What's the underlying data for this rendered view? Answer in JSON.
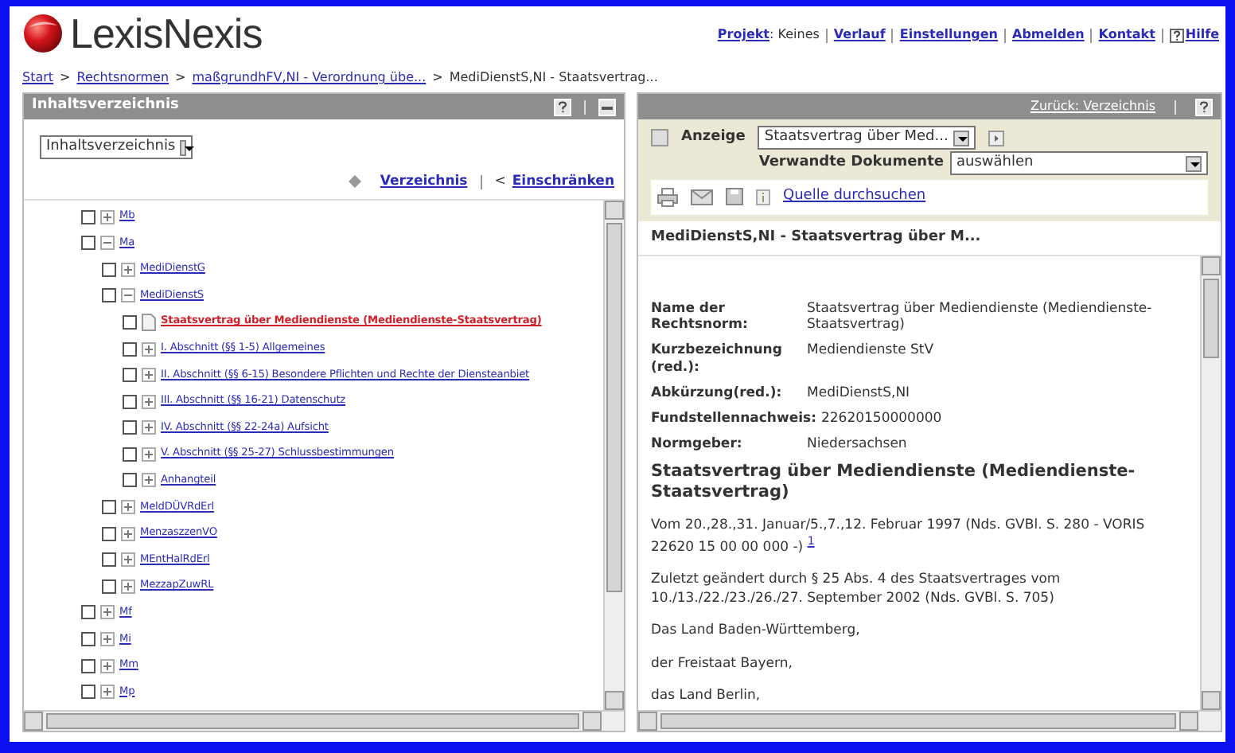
{
  "header": {
    "brand": "LexisNexis",
    "links": [
      {
        "label": "Projekt",
        "suffix": ": Keines"
      },
      {
        "label": "Verlauf"
      },
      {
        "label": "Einstellungen"
      },
      {
        "label": "Abmelden"
      },
      {
        "label": "Kontakt"
      },
      {
        "label": "Hilfe",
        "kind": "help"
      }
    ]
  },
  "breadcrumb": {
    "separator": ">",
    "items": [
      {
        "label": "Start",
        "link": true
      },
      {
        "label": "Rechtsnormen",
        "link": true
      },
      {
        "label": "maßgrundhFV,NI - Verordnung übe...",
        "link": true
      },
      {
        "label": "MediDienstS,NI - Staatsvertrag...",
        "link": false
      }
    ]
  },
  "left_panel": {
    "title": "Inhaltsverzeichnis",
    "view_select": "Inhaltsverzeichnis",
    "links": [
      "Verzeichnis",
      "Einschränken"
    ],
    "restrict_prefix": "<",
    "tree": [
      {
        "label": "Mb",
        "kind": "folder",
        "checked": false,
        "expanded": false,
        "selected": false
      },
      {
        "label": "Ma",
        "kind": "folder",
        "checked": false,
        "expanded": true,
        "selected": false,
        "children": [
          {
            "label": "MediDienstG",
            "kind": "folder",
            "checked": false,
            "expanded": false,
            "selected": false
          },
          {
            "label": "MediDienstS",
            "kind": "folder",
            "checked": false,
            "expanded": true,
            "selected": false,
            "children": [
              {
                "label": "Staatsvertrag über Mediendienste (Mediendienste-Staatsvertrag)",
                "kind": "document",
                "checked": false,
                "selected": true
              },
              {
                "label": "I. Abschnitt (§§ 1-5) Allgemeines",
                "kind": "folder",
                "checked": false,
                "expanded": false,
                "selected": false
              },
              {
                "label": "II. Abschnitt (§§ 6-15) Besondere Pflichten und Rechte der Diensteanbiet",
                "kind": "folder",
                "checked": false,
                "expanded": false,
                "selected": false
              },
              {
                "label": "III. Abschnitt (§§ 16-21) Datenschutz",
                "kind": "folder",
                "checked": false,
                "expanded": false,
                "selected": false
              },
              {
                "label": "IV. Abschnitt (§§ 22-24a) Aufsicht",
                "kind": "folder",
                "checked": false,
                "expanded": false,
                "selected": false
              },
              {
                "label": "V. Abschnitt (§§ 25-27) Schlussbestimmungen",
                "kind": "folder",
                "checked": false,
                "expanded": false,
                "selected": false
              },
              {
                "label": "Anhangteil",
                "kind": "folder",
                "checked": false,
                "expanded": false,
                "selected": false
              }
            ]
          },
          {
            "label": "MeldDÜVRdErl",
            "kind": "folder",
            "checked": false,
            "expanded": false,
            "selected": false
          },
          {
            "label": "MenzaszzenVO",
            "kind": "folder",
            "checked": false,
            "expanded": false,
            "selected": false
          },
          {
            "label": "MEntHalRdErl",
            "kind": "folder",
            "checked": false,
            "expanded": false,
            "selected": false
          },
          {
            "label": "MezzapZuwRL",
            "kind": "folder",
            "checked": false,
            "expanded": false,
            "selected": false
          }
        ]
      },
      {
        "label": "Mf",
        "kind": "folder",
        "checked": false,
        "expanded": false,
        "selected": false
      },
      {
        "label": "Mi",
        "kind": "folder",
        "checked": false,
        "expanded": false,
        "selected": false
      },
      {
        "label": "Mm",
        "kind": "folder",
        "checked": false,
        "expanded": false,
        "selected": false
      },
      {
        "label": "Mp",
        "kind": "folder",
        "checked": false,
        "expanded": false,
        "selected": false
      }
    ]
  },
  "right_panel": {
    "back_link": "Zurück: Verzeichnis",
    "display_label": "Anzeige",
    "display_select": "Staatsvertrag über Med...",
    "related_label": "Verwandte Dokumente",
    "related_select": "auswählen",
    "search_source_link": "Quelle durchsuchen",
    "doc_title": "MediDienstS,NI - Staatsvertrag über M...",
    "fields": [
      {
        "label": "Name der Rechtsnorm:",
        "value": "Staatsvertrag über Mediendienste (Mediendienste-Staatsvertrag)"
      },
      {
        "label": "Kurzbezeichnung (red.):",
        "value": "Mediendienste StV"
      },
      {
        "label": "Abkürzung(red.):",
        "value": "MediDienstS,NI"
      },
      {
        "label": "Fundstellennachweis:",
        "value": "22620150000000"
      },
      {
        "label": "Normgeber:",
        "value": "Niedersachsen"
      }
    ],
    "heading": "Staatsvertrag über Mediendienste (Mediendienste-Staatsvertrag)",
    "paragraphs": [
      {
        "text": "Vom 20.,28.,31. Januar/5.,7.,12. Februar 1997 (Nds. GVBl. S. 280 - VORIS 22620 15 00 00 000 -)",
        "footnote": "1"
      },
      {
        "text": "Zuletzt geändert durch § 25 Abs. 4 des Staatsvertrages vom 10./13./22./23./26./27. September 2002 (Nds. GVBl. S. 705)"
      },
      {
        "text": "Das Land Baden-Württemberg,"
      },
      {
        "text": "der Freistaat Bayern,"
      },
      {
        "text": "das Land Berlin,"
      }
    ]
  }
}
